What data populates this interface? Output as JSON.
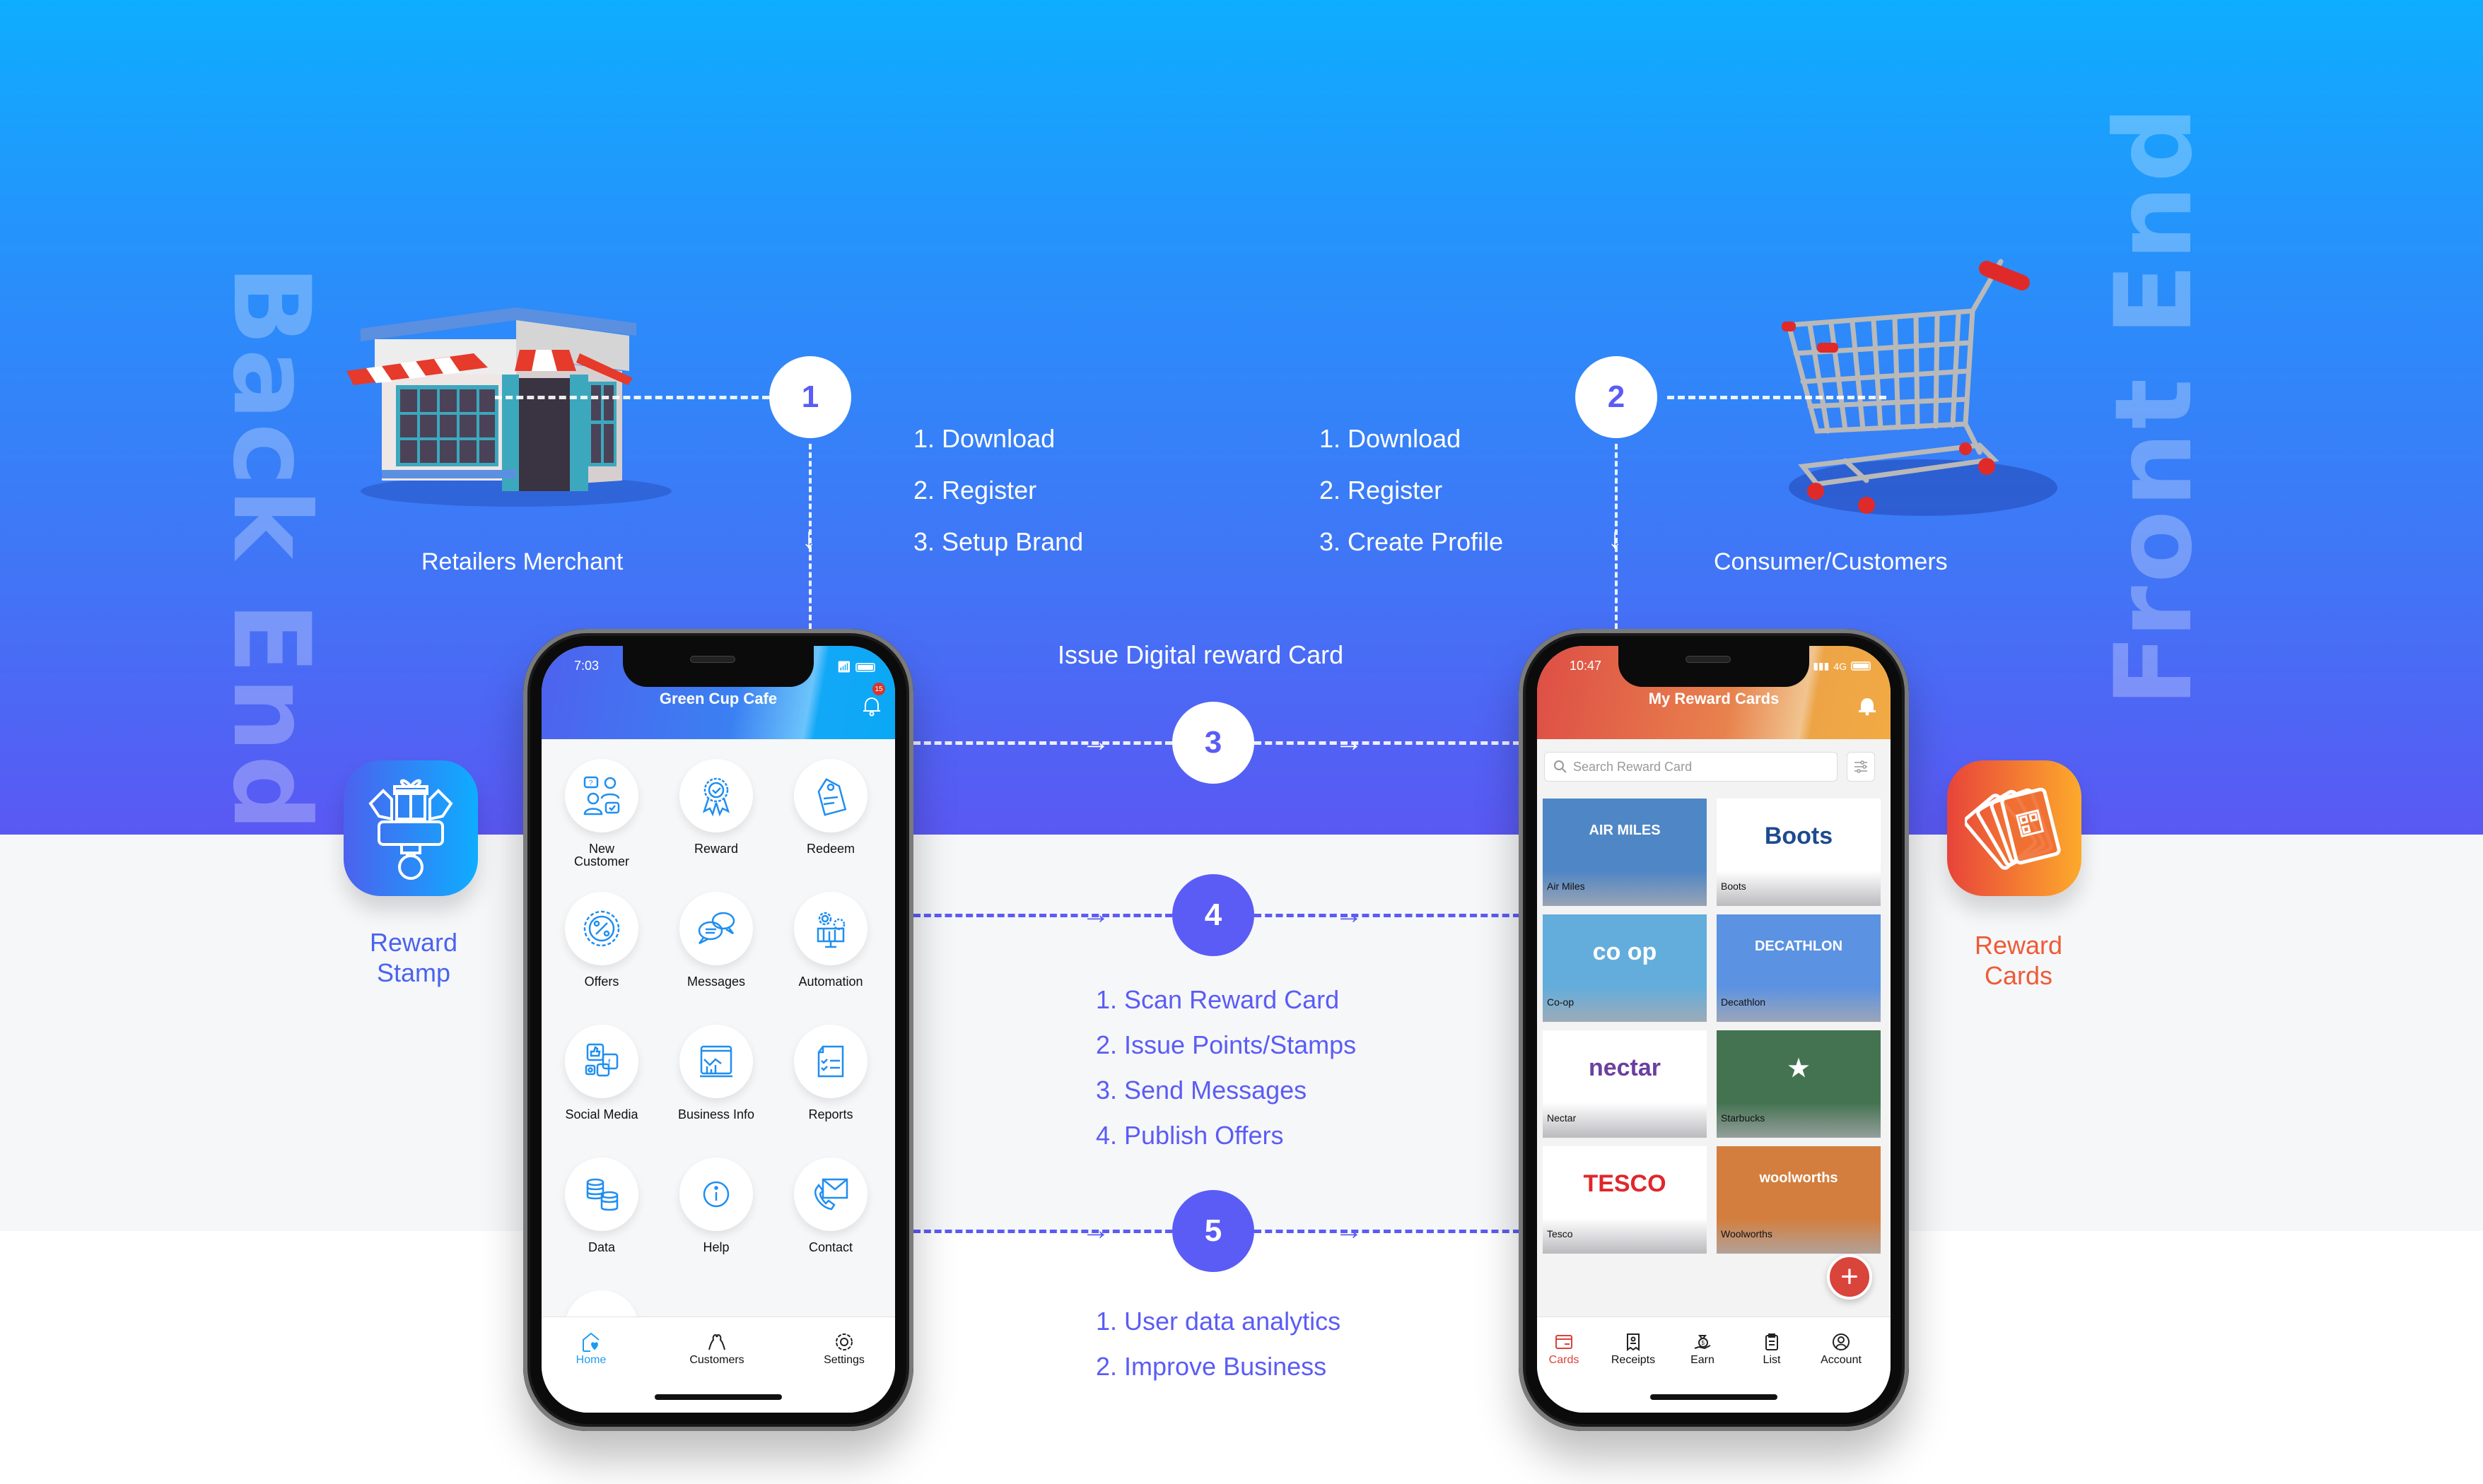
{
  "sections": {
    "back_end_label": "Back End",
    "front_end_label": "Front End"
  },
  "merchant": {
    "label": "Retailers Merchant",
    "step_number": "1",
    "steps": [
      "1. Download",
      "2. Register",
      "3. Setup Brand"
    ]
  },
  "customer": {
    "label": "Consumer/Customers",
    "step_number": "2",
    "steps": [
      "1. Download",
      "2. Register",
      "3. Create Profile"
    ]
  },
  "step3": {
    "number": "3",
    "label": "Issue Digital reward Card"
  },
  "step4": {
    "number": "4",
    "items": [
      "1. Scan Reward Card",
      "2. Issue Points/Stamps",
      "3. Send Messages",
      "4. Publish Offers"
    ]
  },
  "step5": {
    "number": "5",
    "items": [
      "1. User data analytics",
      "2. Improve Business"
    ]
  },
  "reward_stamp": {
    "line1": "Reward",
    "line2": "Stamp",
    "color": "#4A63EE"
  },
  "reward_cards": {
    "line1": "Reward",
    "line2": "Cards",
    "color": "#EE5B36"
  },
  "merchant_app": {
    "time": "7:03",
    "title": "Green Cup Cafe",
    "notification_count": "15",
    "menu": [
      {
        "label": "New Customer",
        "icon": "customers-chat-icon"
      },
      {
        "label": "Reward",
        "icon": "award-badge-icon"
      },
      {
        "label": "Redeem",
        "icon": "tag-icon"
      },
      {
        "label": "Offers",
        "icon": "percent-badge-icon"
      },
      {
        "label": "Messages",
        "icon": "chat-bubbles-icon"
      },
      {
        "label": "Automation",
        "icon": "gears-chart-icon"
      },
      {
        "label": "Social Media",
        "icon": "social-media-icon"
      },
      {
        "label": "Business Info",
        "icon": "dashboard-chart-icon"
      },
      {
        "label": "Reports",
        "icon": "checklist-icon"
      },
      {
        "label": "Data",
        "icon": "database-sync-icon"
      },
      {
        "label": "Help",
        "icon": "info-icon"
      },
      {
        "label": "Contact",
        "icon": "mail-phone-icon"
      }
    ],
    "tabs": [
      {
        "label": "Home",
        "active": true
      },
      {
        "label": "Customers",
        "active": false
      },
      {
        "label": "Settings",
        "active": false
      }
    ],
    "accent": "#1F9BF0"
  },
  "customer_app": {
    "time": "10:47",
    "network": "4G",
    "title": "My Reward Cards",
    "search_placeholder": "Search Reward Card",
    "cards": [
      {
        "name": "Air Miles",
        "bg": "#4F86C6",
        "logo": "AIR MILES",
        "logo_color": "#ffffff"
      },
      {
        "name": "Boots",
        "bg": "#ffffff",
        "logo": "Boots",
        "logo_color": "#1E4A8F"
      },
      {
        "name": "Co-op",
        "bg": "#63ADDC",
        "logo": "co op",
        "logo_color": "#ffffff"
      },
      {
        "name": "Decathlon",
        "bg": "#5B92E2",
        "logo": "DECATHLON",
        "logo_color": "#ffffff"
      },
      {
        "name": "Nectar",
        "bg": "#ffffff",
        "logo": "nectar",
        "logo_color": "#6B3FA0"
      },
      {
        "name": "Starbucks",
        "bg": "#437350",
        "logo": "★",
        "logo_color": "#ffffff"
      },
      {
        "name": "Tesco",
        "bg": "#ffffff",
        "logo": "TESCO",
        "logo_color": "#E0262B"
      },
      {
        "name": "Woolworths",
        "bg": "#D37E3E",
        "logo": "woolworths",
        "logo_color": "#ffffff"
      }
    ],
    "tabs": [
      {
        "label": "Cards",
        "active": true
      },
      {
        "label": "Receipts",
        "active": false
      },
      {
        "label": "Earn",
        "active": false
      },
      {
        "label": "List",
        "active": false
      },
      {
        "label": "Account",
        "active": false
      }
    ],
    "fab_label": "+",
    "accent": "#D8443B"
  }
}
